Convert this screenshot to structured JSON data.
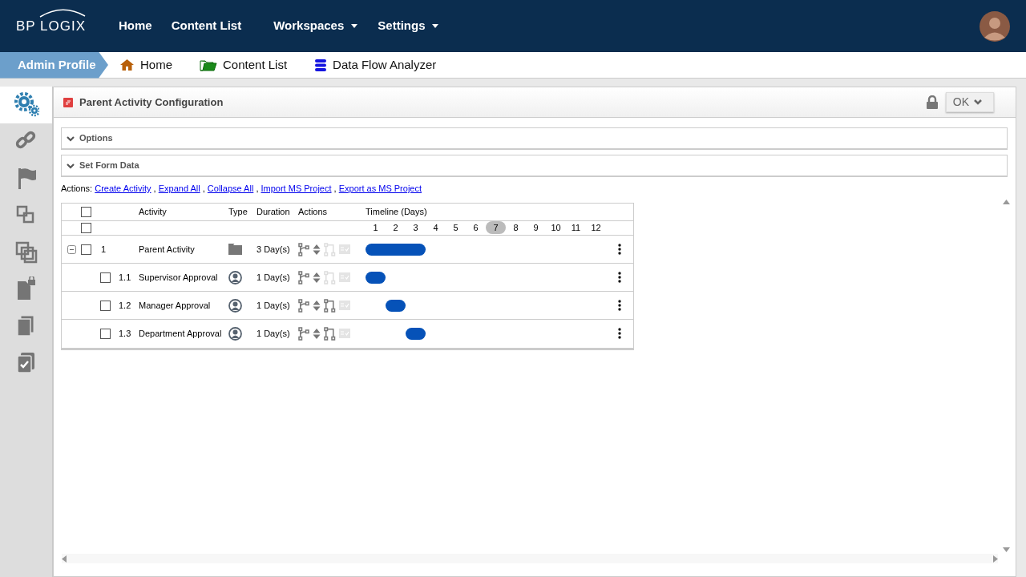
{
  "top_nav": {
    "logo": "BP LOGIX",
    "links": [
      {
        "label": "Home",
        "dropdown": false
      },
      {
        "label": "Content List",
        "dropdown": false
      },
      {
        "label": "Workspaces",
        "dropdown": true
      },
      {
        "label": "Settings",
        "dropdown": true
      }
    ]
  },
  "breadcrumb": {
    "profile": "Admin Profile",
    "items": [
      {
        "kind": "home",
        "label": "Home"
      },
      {
        "kind": "folder",
        "label": "Content List"
      },
      {
        "kind": "database",
        "label": "Data Flow Analyzer"
      }
    ]
  },
  "sidebar": {
    "items": [
      {
        "kind": "gears",
        "selected": true
      },
      {
        "kind": "link",
        "selected": false
      },
      {
        "kind": "flag",
        "selected": false
      },
      {
        "kind": "squares",
        "selected": false
      },
      {
        "kind": "overlap",
        "selected": false
      },
      {
        "kind": "filelock",
        "selected": false
      },
      {
        "kind": "copy",
        "selected": false
      },
      {
        "kind": "checkcopy",
        "selected": false
      }
    ]
  },
  "panel": {
    "title": "Parent Activity Configuration",
    "locked": true,
    "ok_button": "OK",
    "sections": [
      {
        "title": "Options",
        "expanded": false
      },
      {
        "title": "Set Form Data",
        "expanded": false
      }
    ],
    "actions_label": "Actions:",
    "action_links": [
      "Create Activity",
      "Expand All",
      "Collapse All",
      "Import MS Project",
      "Export as MS Project"
    ],
    "separator": ","
  },
  "table": {
    "columns": [
      "Activity",
      "Type",
      "Duration",
      "Actions",
      "Timeline (Days)"
    ],
    "header_checked": false,
    "subheader_checked": false,
    "days": [
      {
        "label": "1",
        "selected": false
      },
      {
        "label": "2",
        "selected": false
      },
      {
        "label": "3",
        "selected": false
      },
      {
        "label": "4",
        "selected": false
      },
      {
        "label": "5",
        "selected": false
      },
      {
        "label": "6",
        "selected": false
      },
      {
        "label": "7",
        "selected": true
      },
      {
        "label": "8",
        "selected": false
      },
      {
        "label": "9",
        "selected": false
      },
      {
        "label": "10",
        "selected": false
      },
      {
        "label": "11",
        "selected": false
      },
      {
        "label": "12",
        "selected": false
      }
    ],
    "rows": [
      {
        "number": "1",
        "activity": "Parent Activity",
        "kind": "folder",
        "duration": "3 Day(s)",
        "checked": false,
        "expanded": true,
        "connect_disabled": true,
        "complete_disabled": true,
        "timeline": [
          {
            "filled": true
          },
          {
            "filled": true
          },
          {
            "filled": true
          },
          {
            "filled": false
          },
          {
            "filled": false
          },
          {
            "filled": false
          },
          {
            "filled": false
          },
          {
            "filled": false
          },
          {
            "filled": false
          },
          {
            "filled": false
          },
          {
            "filled": false
          },
          {
            "filled": false
          }
        ],
        "children": [
          {
            "number": "1.1",
            "activity": "Supervisor Approval",
            "kind": "user",
            "duration": "1 Day(s)",
            "checked": false,
            "connect_disabled": true,
            "complete_disabled": true,
            "timeline": [
              {
                "filled": true
              },
              {
                "filled": false
              },
              {
                "filled": false
              },
              {
                "filled": false
              },
              {
                "filled": false
              },
              {
                "filled": false
              },
              {
                "filled": false
              },
              {
                "filled": false
              },
              {
                "filled": false
              },
              {
                "filled": false
              },
              {
                "filled": false
              },
              {
                "filled": false
              }
            ]
          },
          {
            "number": "1.2",
            "activity": "Manager Approval",
            "kind": "user",
            "duration": "1 Day(s)",
            "checked": false,
            "connect_disabled": false,
            "complete_disabled": true,
            "timeline": [
              {
                "filled": false
              },
              {
                "filled": true
              },
              {
                "filled": false
              },
              {
                "filled": false
              },
              {
                "filled": false
              },
              {
                "filled": false
              },
              {
                "filled": false
              },
              {
                "filled": false
              },
              {
                "filled": false
              },
              {
                "filled": false
              },
              {
                "filled": false
              },
              {
                "filled": false
              }
            ]
          },
          {
            "number": "1.3",
            "activity": "Department Approval",
            "kind": "user",
            "duration": "1 Day(s)",
            "checked": false,
            "connect_disabled": false,
            "complete_disabled": true,
            "timeline": [
              {
                "filled": false
              },
              {
                "filled": false
              },
              {
                "filled": true
              },
              {
                "filled": false
              },
              {
                "filled": false
              },
              {
                "filled": false
              },
              {
                "filled": false
              },
              {
                "filled": false
              },
              {
                "filled": false
              },
              {
                "filled": false
              },
              {
                "filled": false
              },
              {
                "filled": false
              }
            ]
          }
        ]
      }
    ]
  }
}
